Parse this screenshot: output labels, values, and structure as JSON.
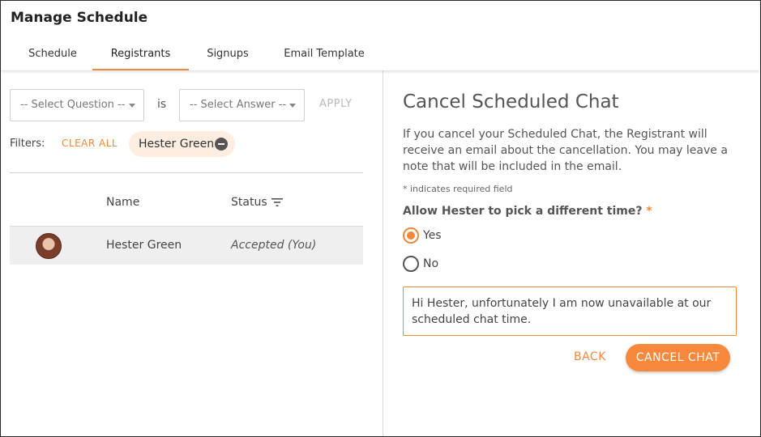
{
  "app": {
    "title": "Manage Schedule"
  },
  "tabs": [
    {
      "label": "Schedule",
      "active": false
    },
    {
      "label": "Registrants",
      "active": true
    },
    {
      "label": "Signups",
      "active": false
    },
    {
      "label": "Email Template",
      "active": false
    }
  ],
  "filter_bar": {
    "question_select": "-- Select Question --",
    "is_label": "is",
    "answer_select": "-- Select Answer --",
    "apply_label": "APPLY",
    "filters_label": "Filters:",
    "clear_all_label": "CLEAR ALL",
    "active_filter_chip": "Hester Green"
  },
  "table": {
    "columns": {
      "name": "Name",
      "status": "Status"
    },
    "rows": [
      {
        "name": "Hester Green",
        "status": "Accepted (You)",
        "selected": true
      }
    ]
  },
  "cancel_panel": {
    "title": "Cancel Scheduled Chat",
    "description": "If you cancel your Scheduled Chat, the Registrant will receive an email about the cancellation. You may leave a note that will be included in the email.",
    "required_note": "* indicates required field",
    "question": "Allow Hester to pick a different time?",
    "required_marker": "*",
    "options": [
      {
        "label": "Yes",
        "checked": true
      },
      {
        "label": "No",
        "checked": false
      }
    ],
    "note_text": "Hi Hester, unfortunately I am now unavailable at our scheduled chat time.",
    "back_label": "BACK",
    "cancel_label": "CANCEL CHAT"
  },
  "colors": {
    "accent": "#f0883b",
    "chip_bg": "#fdeee1",
    "row_selected": "#efefef"
  }
}
